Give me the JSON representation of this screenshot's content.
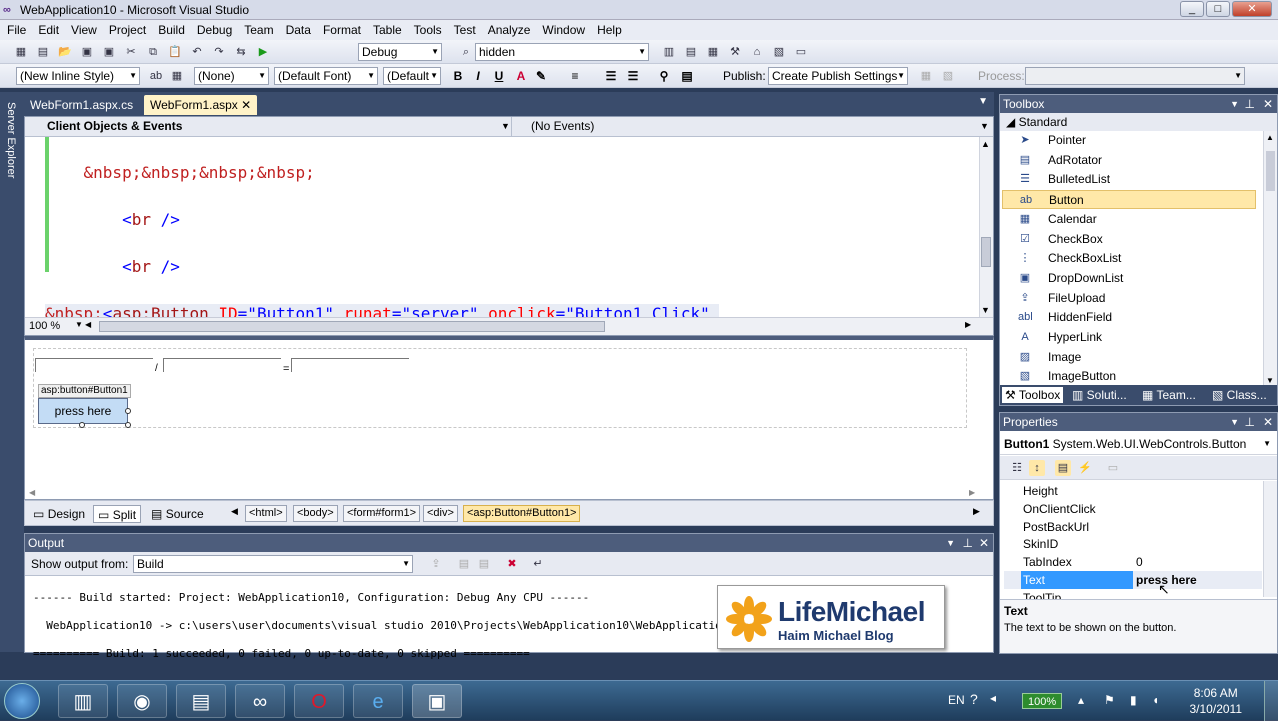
{
  "window": {
    "title": "WebApplication10 - Microsoft Visual Studio",
    "minimize": "_",
    "maximize": "□",
    "close": "✕"
  },
  "menu": [
    "File",
    "Edit",
    "View",
    "Project",
    "Build",
    "Debug",
    "Team",
    "Data",
    "Format",
    "Table",
    "Tools",
    "Test",
    "Analyze",
    "Window",
    "Help"
  ],
  "toolbar1": {
    "config": "Debug",
    "find": "hidden"
  },
  "toolbar2": {
    "style": "(New Inline Style)",
    "target": "(None)",
    "font": "(Default Font)",
    "size": "(Default",
    "publish_label": "Publish:",
    "publish_value": "Create Publish Settings",
    "process_label": "Process:"
  },
  "sidebar": {
    "server_explorer": "Server Explorer"
  },
  "tabs": [
    {
      "label": "WebForm1.aspx.cs",
      "active": false
    },
    {
      "label": "WebForm1.aspx",
      "active": true
    }
  ],
  "editor": {
    "left_dropdown": "Client Objects & Events",
    "right_dropdown": "(No Events)",
    "zoom": "100 %"
  },
  "design": {
    "button_tag": "asp:button#Button1",
    "button_text": "press here"
  },
  "views": {
    "design": "Design",
    "split": "Split",
    "source": "Source"
  },
  "breadcrumbs": [
    "<html>",
    "<body>",
    "<form#form1>",
    "<div>",
    "<asp:Button#Button1>"
  ],
  "output": {
    "title": "Output",
    "show_from_label": "Show output from:",
    "show_from_value": "Build",
    "lines": [
      "------ Build started: Project: WebApplication10, Configuration: Debug Any CPU ------",
      "  WebApplication10 -> c:\\users\\user\\documents\\visual studio 2010\\Projects\\WebApplication10\\WebApplicatio",
      "========== Build: 1 succeeded, 0 failed, 0 up-to-date, 0 skipped =========="
    ]
  },
  "watermark": {
    "brand": "LifeMichael",
    "sub": "Haim Michael Blog"
  },
  "toolbox": {
    "title": "Toolbox",
    "section": "Standard",
    "items": [
      {
        "label": "Pointer",
        "icon": "pointer-icon",
        "glyph": "➤"
      },
      {
        "label": "AdRotator",
        "icon": "adrotator-icon",
        "glyph": "▤"
      },
      {
        "label": "BulletedList",
        "icon": "bulleted-list-icon",
        "glyph": "☰"
      },
      {
        "label": "Button",
        "icon": "button-icon",
        "glyph": "ab"
      },
      {
        "label": "Calendar",
        "icon": "calendar-icon",
        "glyph": "▦"
      },
      {
        "label": "CheckBox",
        "icon": "checkbox-icon",
        "glyph": "☑"
      },
      {
        "label": "CheckBoxList",
        "icon": "checkbox-list-icon",
        "glyph": "⋮"
      },
      {
        "label": "DropDownList",
        "icon": "dropdown-list-icon",
        "glyph": "▣"
      },
      {
        "label": "FileUpload",
        "icon": "file-upload-icon",
        "glyph": "⇪"
      },
      {
        "label": "HiddenField",
        "icon": "hidden-field-icon",
        "glyph": "abl"
      },
      {
        "label": "HyperLink",
        "icon": "hyperlink-icon",
        "glyph": "A"
      },
      {
        "label": "Image",
        "icon": "image-icon",
        "glyph": "▨"
      },
      {
        "label": "ImageButton",
        "icon": "image-button-icon",
        "glyph": "▧"
      }
    ],
    "bottom_tabs": [
      "Toolbox",
      "Soluti...",
      "Team...",
      "Class..."
    ]
  },
  "properties": {
    "title": "Properties",
    "object": "Button1",
    "object_type": "System.Web.UI.WebControls.Button",
    "rows": [
      {
        "name": "Height",
        "value": ""
      },
      {
        "name": "OnClientClick",
        "value": ""
      },
      {
        "name": "PostBackUrl",
        "value": ""
      },
      {
        "name": "SkinID",
        "value": ""
      },
      {
        "name": "TabIndex",
        "value": "0"
      },
      {
        "name": "Text",
        "value": "press here",
        "selected": true
      },
      {
        "name": "ToolTip",
        "value": ""
      }
    ],
    "desc_title": "Text",
    "desc_text": "The text to be shown on the button."
  },
  "taskbar": {
    "lang": "EN",
    "battery": "100%",
    "time": "8:06 AM",
    "date": "3/10/2011"
  }
}
